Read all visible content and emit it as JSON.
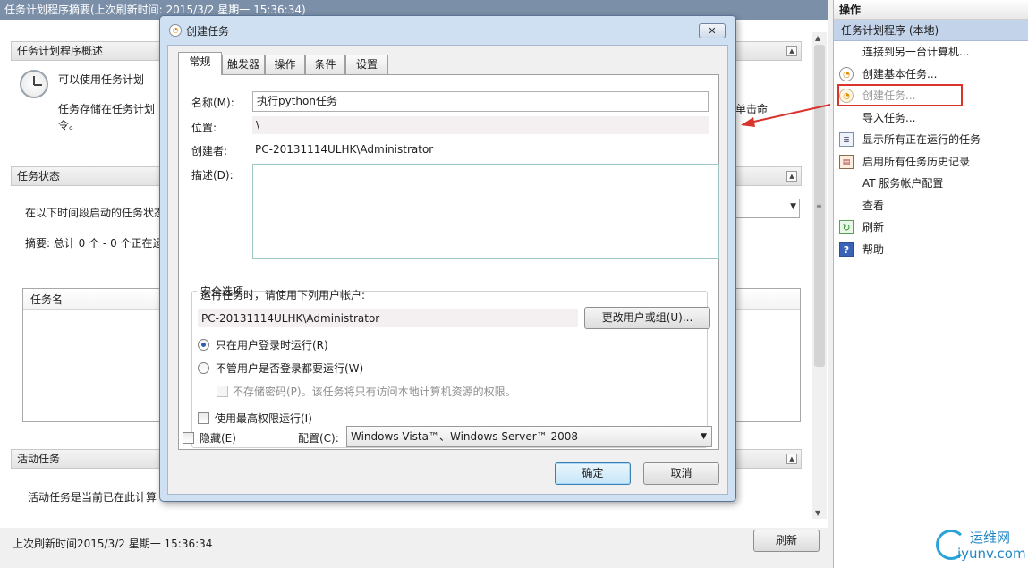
{
  "main": {
    "title": "任务计划程序摘要(上次刷新时间: 2015/3/2 星期一 15:36:34)",
    "overview": {
      "header": "任务计划程序概述",
      "line1": "可以使用任务计划",
      "line2": "任务存储在任务计划",
      "line2_tail": "单击命",
      "line3": "令。"
    },
    "status": {
      "header": "任务状态",
      "period_label": "在以下时间段启动的任务状态",
      "summary": "摘要: 总计 0 个 - 0 个正在运"
    },
    "grid": {
      "column": "任务名"
    },
    "active": {
      "header": "活动任务",
      "text": "活动任务是当前已在此计算"
    },
    "footer": {
      "last_refresh": "上次刷新时间2015/3/2 星期一 15:36:34",
      "refresh_label": "刷新"
    }
  },
  "actions": {
    "header": "操作",
    "group": "任务计划程序 (本地)",
    "items": [
      {
        "label": "连接到另一台计算机...",
        "icon": "computer-icon",
        "enabled": true
      },
      {
        "label": "创建基本任务...",
        "icon": "clock-icon",
        "enabled": true
      },
      {
        "label": "创建任务...",
        "icon": "clock-icon",
        "enabled": false
      },
      {
        "label": "导入任务...",
        "icon": "import-icon",
        "enabled": true
      },
      {
        "label": "显示所有正在运行的任务",
        "icon": "running-tasks-icon",
        "enabled": true
      },
      {
        "label": "启用所有任务历史记录",
        "icon": "history-icon",
        "enabled": true
      },
      {
        "label": "AT 服务帐户配置",
        "icon": "at-service-icon",
        "enabled": true
      },
      {
        "label": "查看",
        "icon": "view-icon",
        "enabled": true
      },
      {
        "label": "刷新",
        "icon": "refresh-icon",
        "enabled": true
      },
      {
        "label": "帮助",
        "icon": "help-icon",
        "enabled": true
      }
    ]
  },
  "dialog": {
    "title": "创建任务",
    "close_symbol": "✕",
    "tabs": [
      "常规",
      "触发器",
      "操作",
      "条件",
      "设置"
    ],
    "active_tab": "常规",
    "name_label": "名称(M):",
    "name_value": "执行python任务",
    "location_label": "位置:",
    "location_value": "\\",
    "author_label": "创建者:",
    "author_value": "PC-20131114ULHK\\Administrator",
    "description_label": "描述(D):",
    "description_value": "",
    "security": {
      "legend": "安全选项",
      "run_as_label": "运行任务时，请使用下列用户帐户:",
      "run_as_value": "PC-20131114ULHK\\Administrator",
      "change_user_button": "更改用户或组(U)...",
      "radio_logged_on": "只在用户登录时运行(R)",
      "radio_whether_logged_on": "不管用户是否登录都要运行(W)",
      "no_store_password": "不存储密码(P)。该任务将只有访问本地计算机资源的权限。",
      "highest_privileges": "使用最高权限运行(I)",
      "selected_radio": "logged_on"
    },
    "hidden_label": "隐藏(E)",
    "configure_label": "配置(C):",
    "configure_value": "Windows Vista™、Windows Server™ 2008",
    "ok_button": "确定",
    "cancel_button": "取消"
  },
  "watermark": {
    "title": "运维网",
    "url": "iyunv.com"
  },
  "colors": {
    "title_bar": "#7b8fa8",
    "dialog_frame": "#cfe0f3",
    "highlight_box": "#d9332c",
    "action_group": "#c3d3ea",
    "watermark": "#1f86c5"
  }
}
